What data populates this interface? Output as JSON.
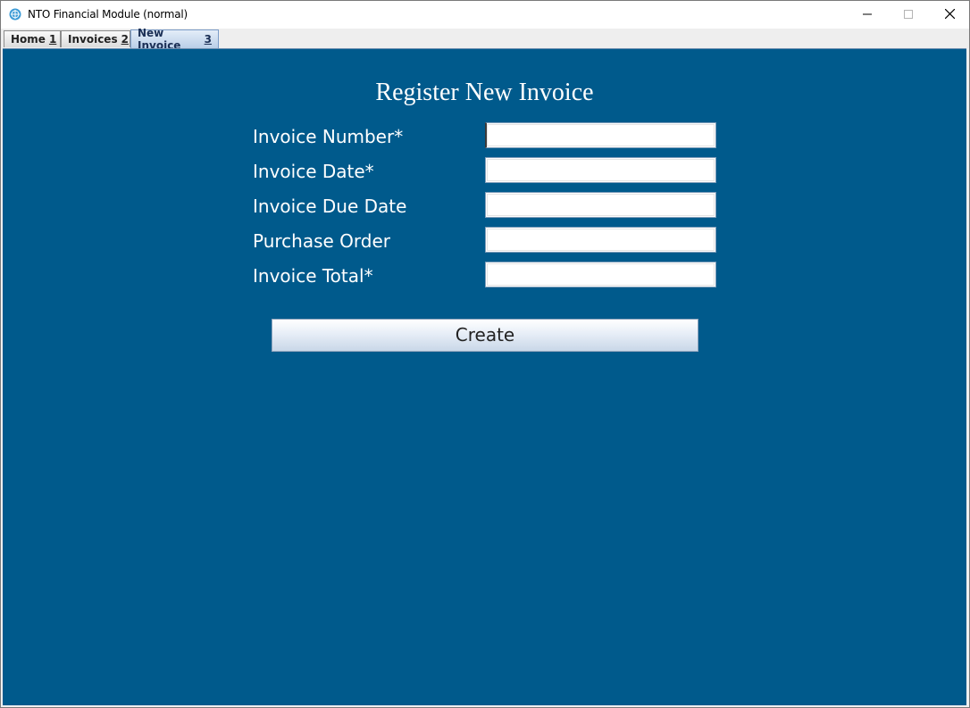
{
  "window": {
    "title": "NTO Financial Module (normal)",
    "icon": "globe-icon",
    "controls": [
      "minimize-icon",
      "maximize-icon",
      "close-icon"
    ]
  },
  "tabs": [
    {
      "label": "Home",
      "mnemonic": "1",
      "active": false
    },
    {
      "label": "Invoices",
      "mnemonic": "2",
      "active": false
    },
    {
      "label": "New Invoice",
      "mnemonic": "3",
      "active": true
    }
  ],
  "form": {
    "heading": "Register New Invoice",
    "fields": [
      {
        "label": "Invoice Number*",
        "value": ""
      },
      {
        "label": "Invoice Date*",
        "value": ""
      },
      {
        "label": "Invoice Due Date",
        "value": ""
      },
      {
        "label": "Purchase Order",
        "value": ""
      },
      {
        "label": "Invoice Total*",
        "value": ""
      }
    ],
    "submit_label": "Create"
  },
  "colors": {
    "content_bg": "#005a8c",
    "label_text": "#ffffff"
  }
}
